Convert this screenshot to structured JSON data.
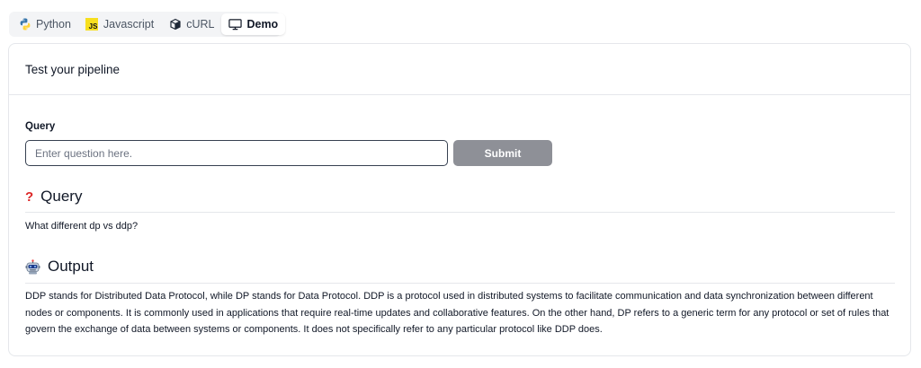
{
  "tabs": [
    {
      "label": "Python",
      "icon": "python-icon"
    },
    {
      "label": "Javascript",
      "icon": "javascript-icon",
      "badge": "JS"
    },
    {
      "label": "cURL",
      "icon": "curl-icon"
    },
    {
      "label": "Demo",
      "icon": "monitor-icon",
      "active": true
    }
  ],
  "card": {
    "title": "Test your pipeline",
    "query_label": "Query",
    "query_placeholder": "Enter question here.",
    "submit_label": "Submit"
  },
  "query_section": {
    "icon": "question-mark-icon",
    "icon_glyph": "?",
    "title": "Query",
    "text": "What different dp vs ddp?"
  },
  "output_section": {
    "icon": "robot-icon",
    "title": "Output",
    "text": "DDP stands for Distributed Data Protocol, while DP stands for Data Protocol. DDP is a protocol used in distributed systems to facilitate communication and data synchronization between different nodes or components. It is commonly used in applications that require real-time updates and collaborative features. On the other hand, DP refers to a generic term for any protocol or set of rules that govern the exchange of data between systems or components. It does not specifically refer to any particular protocol like DDP does."
  },
  "colors": {
    "accent_button": "#8e9097",
    "question_mark": "#dc2626",
    "js_badge": "#f7df1e"
  }
}
